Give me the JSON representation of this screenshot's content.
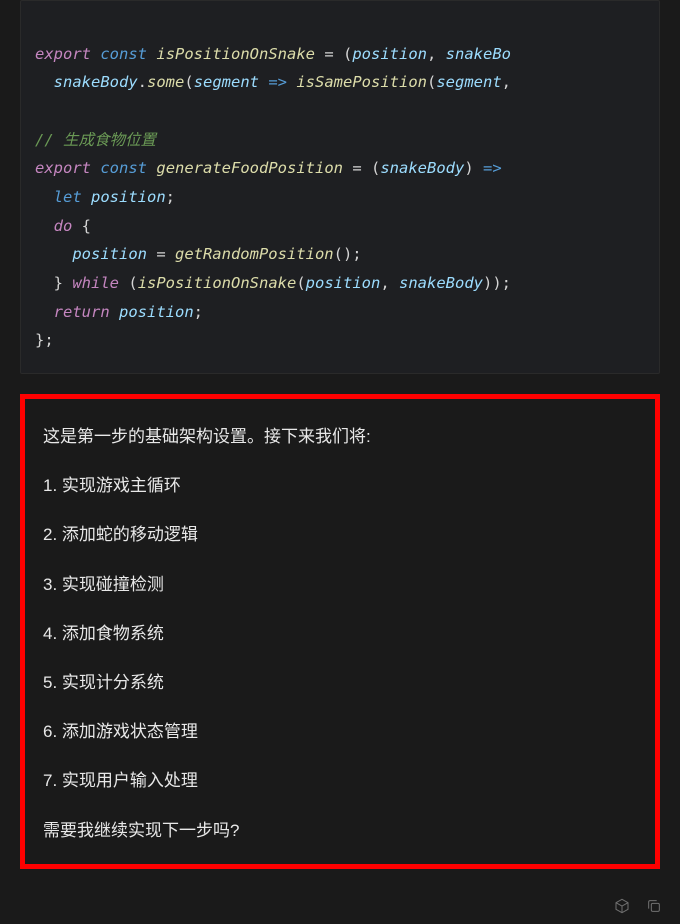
{
  "code": {
    "line1_export": "export",
    "line1_const": "const",
    "line1_fn": "isPositionOnSnake",
    "line1_eq": " = (",
    "line1_p1": "position",
    "line1_c1": ", ",
    "line1_p2": "snakeBo",
    "line2_obj": "snakeBody",
    "line2_dot": ".",
    "line2_some": "some",
    "line2_open": "(",
    "line2_seg": "segment",
    "line2_arrow": " => ",
    "line2_call": "isSamePosition",
    "line2_open2": "(",
    "line2_seg2": "segment",
    "line2_c": ",",
    "comment": "// 生成食物位置",
    "line4_export": "export",
    "line4_const": "const",
    "line4_fn": "generateFoodPosition",
    "line4_eq": " = (",
    "line4_p1": "snakeBody",
    "line4_close": ") ",
    "line4_arrow": "=>",
    "line5_let": "let",
    "line5_var": "position",
    "line5_semi": ";",
    "line6_do": "do",
    "line6_brace": " {",
    "line7_var": "position",
    "line7_eq": " = ",
    "line7_fn": "getRandomPosition",
    "line7_call": "();",
    "line8_brace": "} ",
    "line8_while": "while",
    "line8_open": " (",
    "line8_fn": "isPositionOnSnake",
    "line8_open2": "(",
    "line8_p1": "position",
    "line8_c": ", ",
    "line8_p2": "snakeBody",
    "line8_close": "));",
    "line9_return": "return",
    "line9_var": "position",
    "line9_semi": ";",
    "line10_brace": "};"
  },
  "message": {
    "intro": "这是第一步的基础架构设置。接下来我们将:",
    "items": [
      "1. 实现游戏主循环",
      "2. 添加蛇的移动逻辑",
      "3. 实现碰撞检测",
      "4. 添加食物系统",
      "5. 实现计分系统",
      "6. 添加游戏状态管理",
      "7. 实现用户输入处理"
    ],
    "footer": "需要我继续实现下一步吗?"
  }
}
